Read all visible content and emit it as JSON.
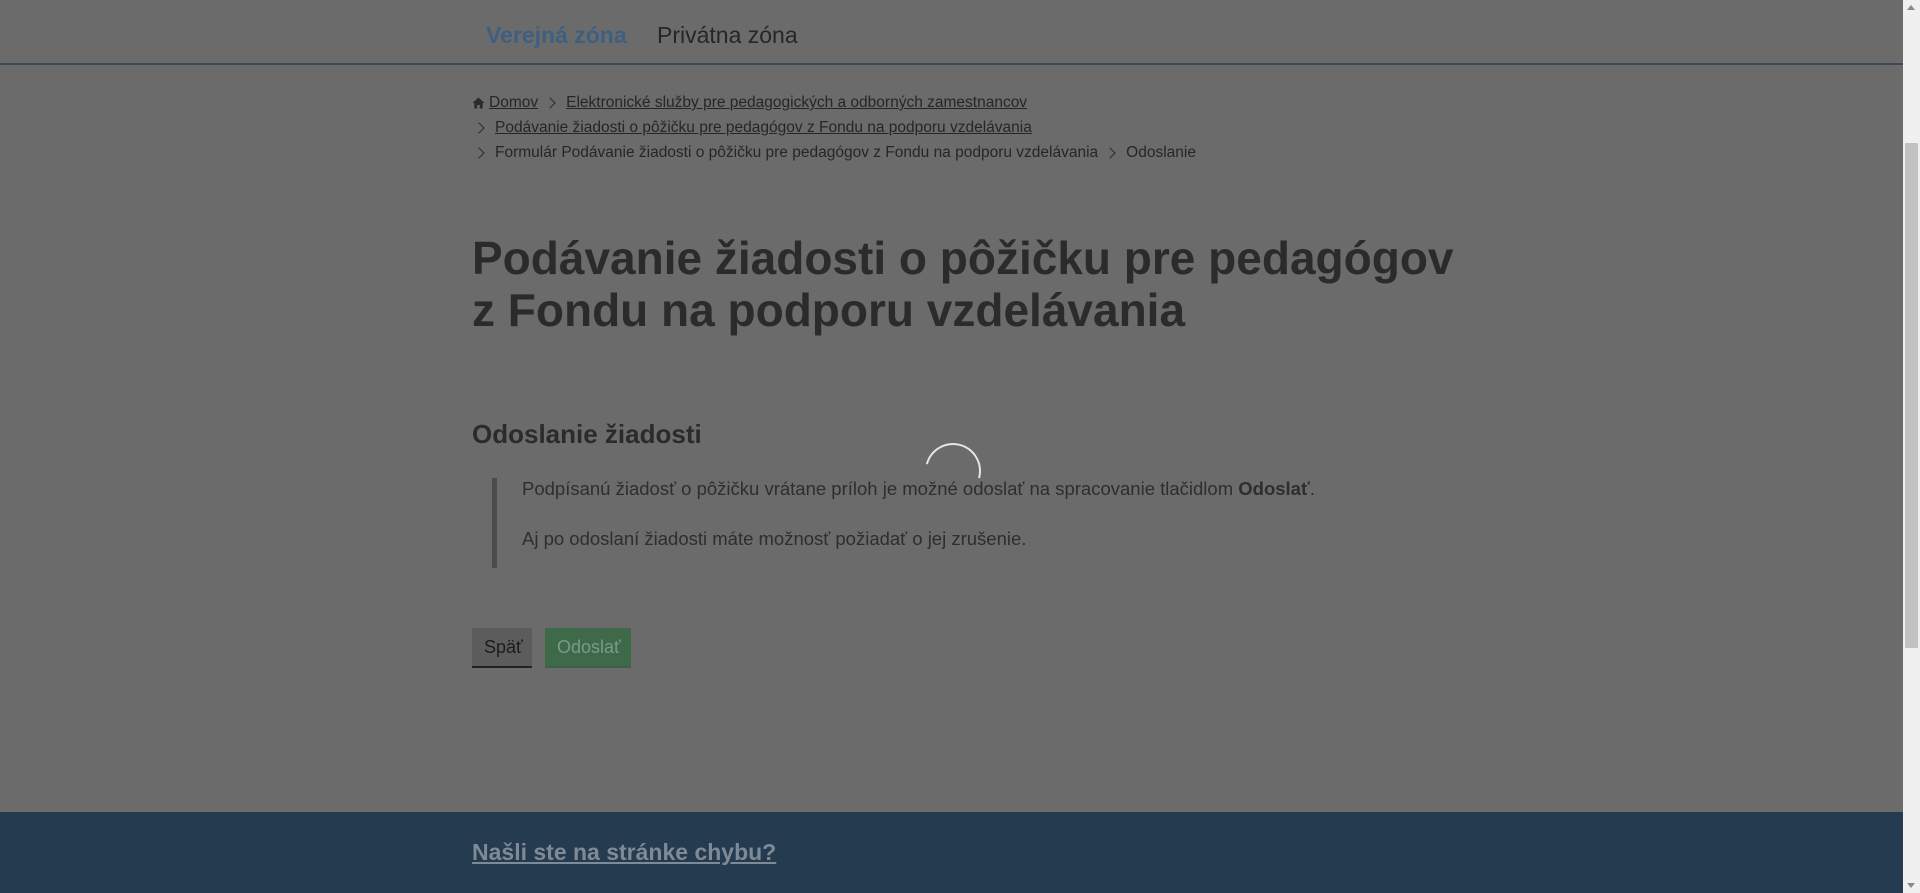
{
  "zones": {
    "public": "Verejná zóna",
    "private": "Privátna zóna"
  },
  "breadcrumb": {
    "home": "Domov",
    "items": [
      "Elektronické služby pre pedagogických a odborných zamestnancov",
      "Podávanie žiadosti o pôžičku pre pedagógov z Fondu na podporu vzdelávania",
      "Formulár Podávanie žiadosti o pôžičku pre pedagógov z Fondu na podporu vzdelávania",
      "Odoslanie"
    ]
  },
  "title": {
    "line1": "Podávanie žiadosti o pôžičku pre pedagógov",
    "line2": "z Fondu na podporu vzdelávania"
  },
  "section": {
    "title": "Odoslanie žiadosti",
    "p1_before": "Podpísanú žiadosť o pôžičku vrátane príloh je možné odoslať na spracovanie tlačidlom ",
    "p1_bold": "Odoslať",
    "p1_after": ".",
    "p2": "Aj po odoslaní žiadosti máte možnosť požiadať o jej zrušenie."
  },
  "buttons": {
    "back": "Späť",
    "submit": "Odoslať"
  },
  "footer": {
    "report_link": "Našli ste na stránke chybu?"
  }
}
